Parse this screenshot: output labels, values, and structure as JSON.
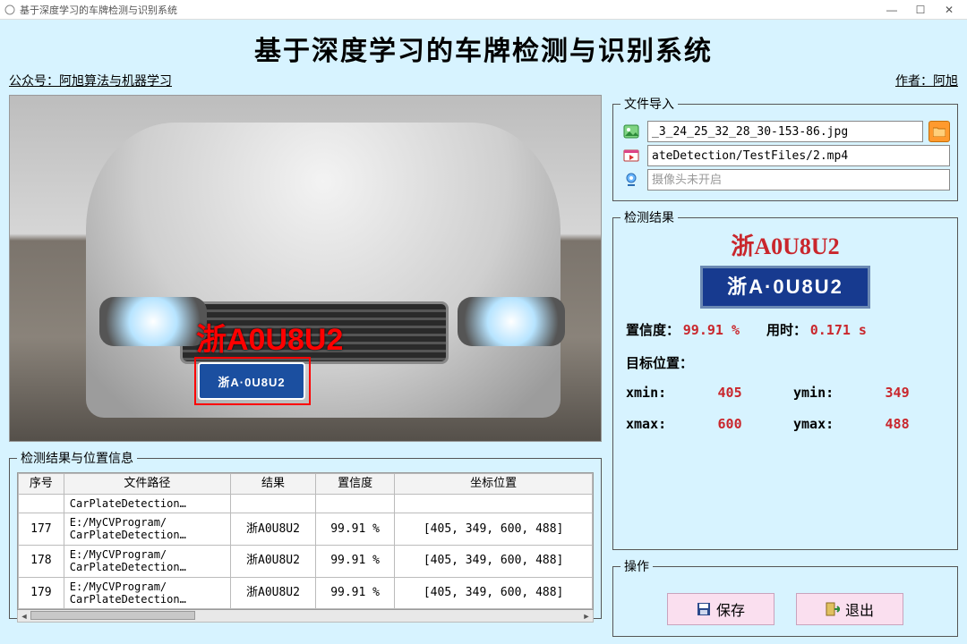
{
  "titlebar": {
    "title": "基于深度学习的车牌检测与识别系统"
  },
  "header": {
    "main_title": "基于深度学习的车牌检测与识别系统",
    "subleft": "公众号：阿旭算法与机器学习",
    "subright": "作者：阿旭"
  },
  "image_overlay": {
    "detected_text": "浙A0U8U2",
    "plate_line1": "浙A·0U8U2",
    "plate_line2": "A·0U8U2"
  },
  "file_import": {
    "legend": "文件导入",
    "image_path": "_3_24_25_32_28_30-153-86.jpg",
    "video_path": "ateDetection/TestFiles/2.mp4",
    "camera_placeholder": "摄像头未开启"
  },
  "result": {
    "legend": "检测结果",
    "plate_text": "浙A0U8U2",
    "plate_render": "浙A·0U8U2",
    "conf_label": "置信度：",
    "conf_value": "99.91 %",
    "time_label": "用时：",
    "time_value": "0.171 s",
    "pos_label": "目标位置：",
    "xmin_l": "xmin:",
    "xmin": "405",
    "ymin_l": "ymin:",
    "ymin": "349",
    "xmax_l": "xmax:",
    "xmax": "600",
    "ymax_l": "ymax:",
    "ymax": "488"
  },
  "ops": {
    "legend": "操作",
    "save": "保存",
    "exit": "退出"
  },
  "table": {
    "legend": "检测结果与位置信息",
    "headers": [
      "序号",
      "文件路径",
      "结果",
      "置信度",
      "坐标位置"
    ],
    "rows": [
      {
        "idx": "",
        "path": "CarPlateDetection…",
        "res": "",
        "conf": "",
        "coord": ""
      },
      {
        "idx": "177",
        "path": "E:/MyCVProgram/\nCarPlateDetection…",
        "res": "浙A0U8U2",
        "conf": "99.91 %",
        "coord": "[405, 349, 600, 488]"
      },
      {
        "idx": "178",
        "path": "E:/MyCVProgram/\nCarPlateDetection…",
        "res": "浙A0U8U2",
        "conf": "99.91 %",
        "coord": "[405, 349, 600, 488]"
      },
      {
        "idx": "179",
        "path": "E:/MyCVProgram/\nCarPlateDetection…",
        "res": "浙A0U8U2",
        "conf": "99.91 %",
        "coord": "[405, 349, 600, 488]"
      }
    ]
  }
}
